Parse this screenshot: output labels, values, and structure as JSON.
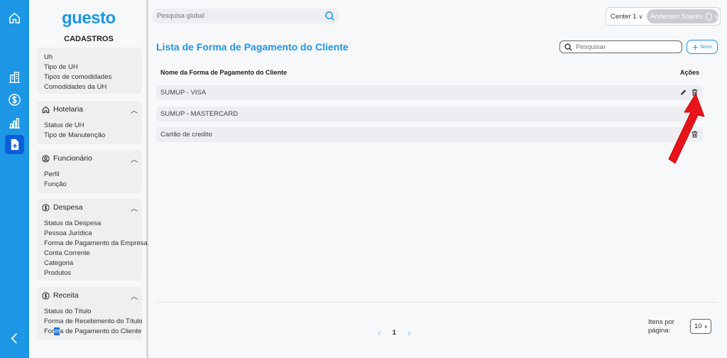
{
  "brand": {
    "logo": "guesto",
    "section": "CADASTROS"
  },
  "nav": {
    "group_uh": {
      "items": [
        "Uh",
        "Tipo de UH",
        "Tipos de comodidades",
        "Comodidades da UH"
      ]
    },
    "groups": [
      {
        "title": "Hotelaria",
        "icon": "home-icon",
        "items": [
          "Status de UH",
          "Tipo de Manutenção"
        ]
      },
      {
        "title": "Funcionário",
        "icon": "user-circle-icon",
        "items": [
          "Perfil",
          "Função"
        ]
      },
      {
        "title": "Despesa",
        "icon": "dollar-circle-icon",
        "items": [
          "Status da Despesa",
          "Pessoa Jurídica",
          "Forma de Pagamento da Empresa",
          "Conta Corrente",
          "Categoria",
          "Produtos"
        ]
      },
      {
        "title": "Receita",
        "icon": "dollar-circle-icon",
        "items": [
          "Status do Título",
          "Forma de Recebimento do Título"
        ]
      }
    ],
    "active_item": {
      "pre": "For",
      "highlight": "m",
      "post": "a de Pagamento do Cliente"
    }
  },
  "topbar": {
    "search_placeholder": "Pesquisa global",
    "center": "Center 1",
    "user": "Anderson Soares"
  },
  "main": {
    "title": "Lista de Forma de Pagamento do Cliente",
    "search_placeholder": "Pesquisar",
    "new_label": "Novo",
    "col_name": "Nome da Forma de Pagamento do Cliente",
    "col_actions": "Ações",
    "rows": [
      "SUMUP - VISA",
      "SUMUP - MASTERCARD",
      "Cartão de credito"
    ]
  },
  "pagination": {
    "page": "1",
    "items_per_page_label": "Itens por página:",
    "items_per_page": "10"
  },
  "colors": {
    "accent": "#1e96e6",
    "rail_active": "#0a5fd6",
    "annotation_arrow": "#e8141c"
  }
}
